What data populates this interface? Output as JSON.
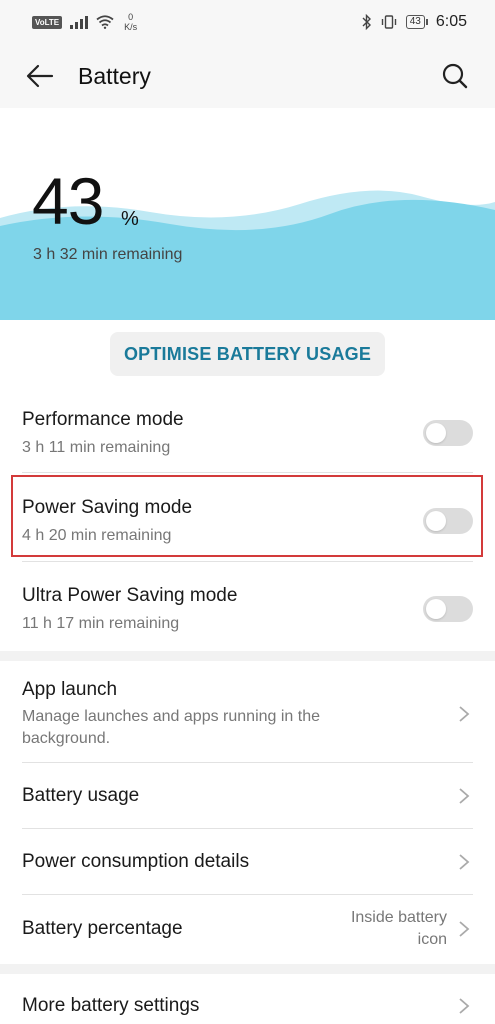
{
  "status_bar": {
    "volte": "VoLTE",
    "net_speed_value": "0",
    "net_speed_unit": "K/s",
    "battery_level": "43",
    "time": "6:05"
  },
  "app_bar": {
    "title": "Battery",
    "back_icon": "arrow-left-icon",
    "search_icon": "search-icon"
  },
  "hero": {
    "percent": "43",
    "percent_sign": "%",
    "remaining": "3 h 32 min remaining",
    "level_fraction": 0.43,
    "wave_color": "#7fd5ea"
  },
  "optimise_button": "OPTIMISE BATTERY USAGE",
  "modes": [
    {
      "title": "Performance mode",
      "subtitle": "3 h 11 min remaining",
      "enabled": false
    },
    {
      "title": "Power Saving mode",
      "subtitle": "4 h 20 min remaining",
      "enabled": false
    },
    {
      "title": "Ultra Power Saving mode",
      "subtitle": "11 h 17 min remaining",
      "enabled": false
    }
  ],
  "settings": [
    {
      "title": "App launch",
      "subtitle": "Manage launches and apps running in the background."
    },
    {
      "title": "Battery usage"
    },
    {
      "title": "Power consumption details"
    },
    {
      "title": "Battery percentage",
      "value": "Inside battery icon"
    }
  ],
  "more_settings": {
    "title": "More battery settings"
  },
  "colors": {
    "accent": "#1a7a9a",
    "highlight": "#d33a3a",
    "toggle_off": "#dcdcdc"
  }
}
